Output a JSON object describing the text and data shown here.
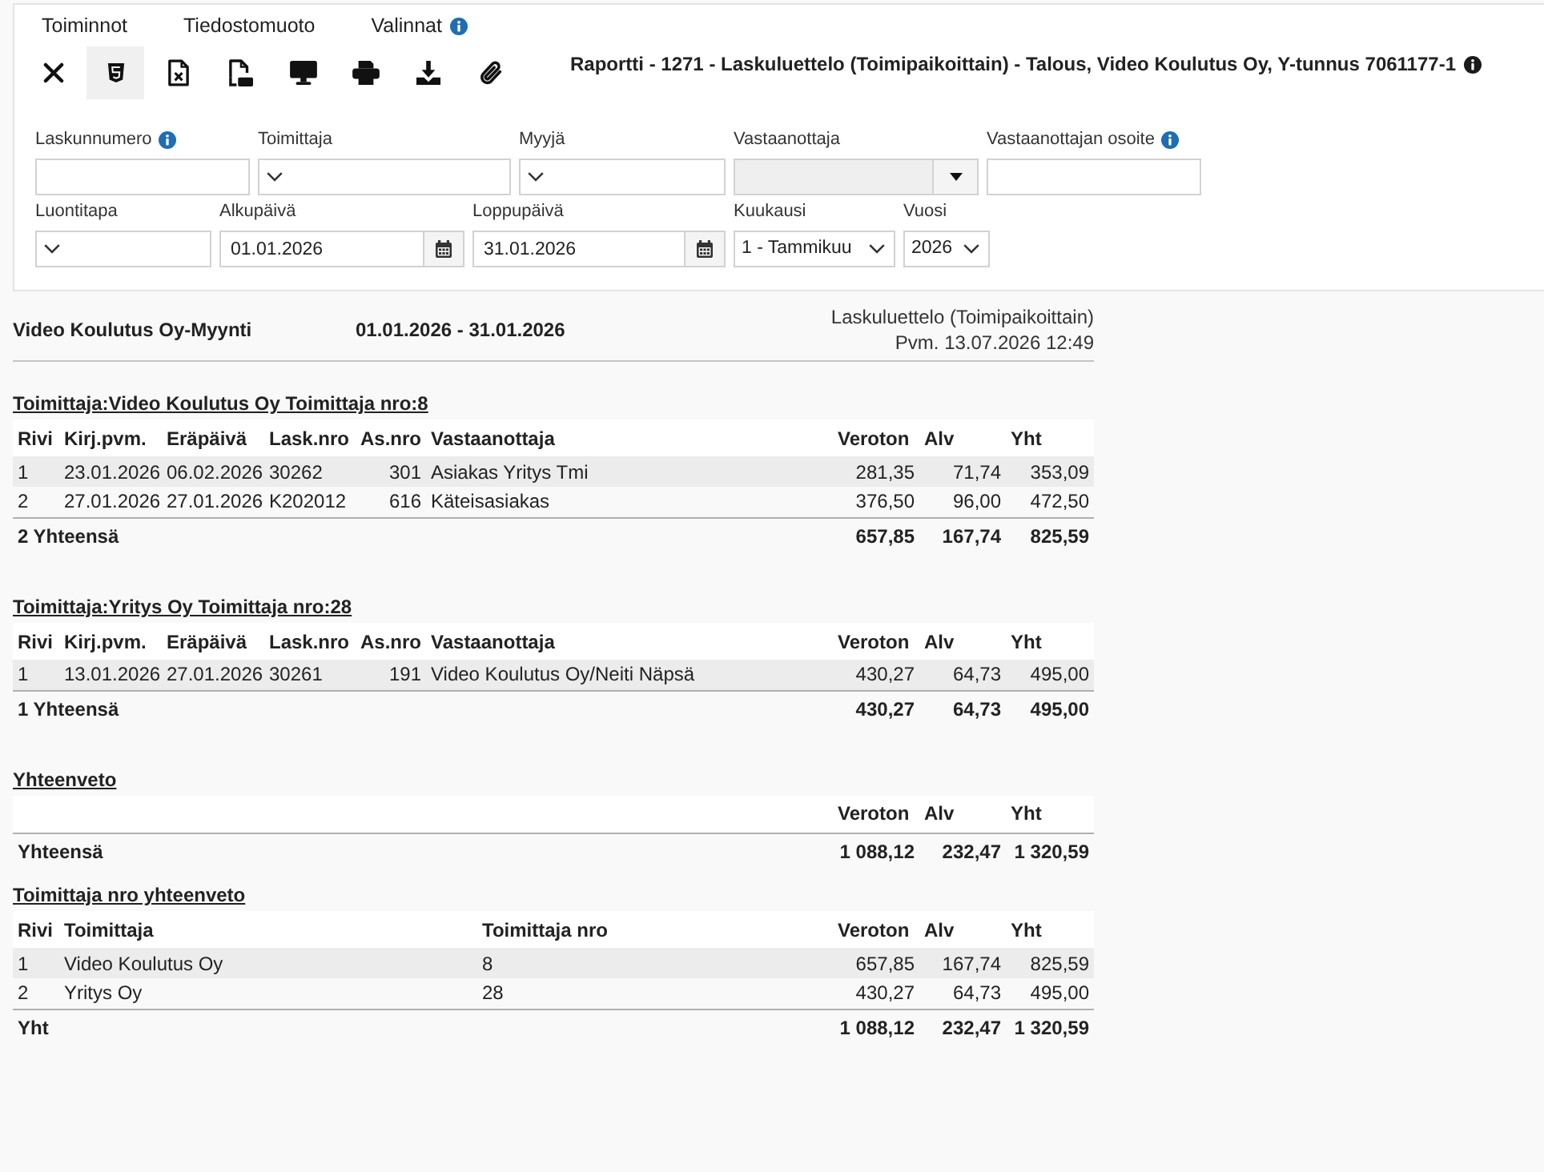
{
  "menu": [
    {
      "label": "Toiminnot",
      "info": false
    },
    {
      "label": "Tiedostomuoto",
      "info": false
    },
    {
      "label": "Valinnat",
      "info": true
    }
  ],
  "toolbar": [
    {
      "kind": "close",
      "selected": false
    },
    {
      "kind": "html",
      "selected": true
    },
    {
      "kind": "excel",
      "selected": false
    },
    {
      "kind": "pdf",
      "selected": false
    },
    {
      "kind": "screen",
      "selected": false
    },
    {
      "kind": "print",
      "selected": false
    },
    {
      "kind": "download",
      "selected": false
    },
    {
      "kind": "attach",
      "selected": false
    }
  ],
  "report_title": {
    "text": "Raportti - 1271 - Laskuluettelo (Toimipaikoittain) - Talous, Video Koulutus Oy, Y-tunnus 7061177-1",
    "info": true
  },
  "filters": [
    [
      {
        "label": "Laskunnumero",
        "kind": "text",
        "info": true,
        "disabled": false
      },
      {
        "label": "Toimittaja",
        "kind": "select",
        "info": false,
        "disabled": false
      },
      {
        "label": "Myyjä",
        "kind": "select",
        "info": false,
        "disabled": false
      },
      {
        "label": "Vastaanottaja",
        "kind": "combo",
        "info": false,
        "disabled": true
      },
      {
        "label": "Vastaanottajan osoite",
        "kind": "text",
        "info": true,
        "disabled": false
      }
    ],
    [
      {
        "label": "Luontitapa",
        "kind": "select",
        "info": false,
        "disabled": false
      },
      {
        "label": "Alkupäivä",
        "kind": "date",
        "info": false,
        "disabled": false,
        "value": "01.01.2026"
      },
      {
        "label": "Loppupäivä",
        "kind": "date",
        "info": false,
        "disabled": false,
        "value": "31.01.2026"
      },
      {
        "label": "Kuukausi",
        "kind": "select",
        "info": false,
        "disabled": false,
        "value": "1 - Tammikuu"
      },
      {
        "label": "Vuosi",
        "kind": "select",
        "info": false,
        "disabled": false,
        "value": "2026"
      }
    ]
  ],
  "report": {
    "company": "Video Koulutus Oy-Myynti",
    "period": "01.01.2026 - 31.01.2026",
    "report_name": "Laskuluettelo (Toimipaikoittain)",
    "printed": "Pvm. 13.07.2026 12:49",
    "sections": [
      {
        "kind": "supplier",
        "heading": "Toimittaja:Video Koulutus Oy Toimittaja nro:8",
        "columns": [
          {
            "label": "Rivi",
            "kind": "text"
          },
          {
            "label": "Kirj.pvm.",
            "kind": "text"
          },
          {
            "label": "Eräpäivä",
            "kind": "text"
          },
          {
            "label": "Lask.nro",
            "kind": "text"
          },
          {
            "label": "As.nro",
            "kind": "num"
          },
          {
            "label": "Vastaanottaja",
            "kind": "text"
          },
          {
            "label": "Veroton",
            "kind": "num"
          },
          {
            "label": "Alv",
            "kind": "num"
          },
          {
            "label": "Yht",
            "kind": "num"
          }
        ],
        "rows": [
          [
            "1",
            "23.01.2026",
            "06.02.2026",
            "30262",
            "301",
            "Asiakas Yritys Tmi",
            "281,35",
            "71,74",
            "353,09"
          ],
          [
            "2",
            "27.01.2026",
            "27.01.2026",
            "K202012",
            "616",
            "Käteisasiakas",
            "376,50",
            "96,00",
            "472,50"
          ]
        ],
        "total": {
          "label": "2 Yhteensä",
          "values": [
            "657,85",
            "167,74",
            "825,59"
          ]
        }
      },
      {
        "kind": "supplier",
        "heading": "Toimittaja:Yritys Oy Toimittaja nro:28",
        "columns": [
          {
            "label": "Rivi",
            "kind": "text"
          },
          {
            "label": "Kirj.pvm.",
            "kind": "text"
          },
          {
            "label": "Eräpäivä",
            "kind": "text"
          },
          {
            "label": "Lask.nro",
            "kind": "text"
          },
          {
            "label": "As.nro",
            "kind": "num"
          },
          {
            "label": "Vastaanottaja",
            "kind": "text"
          },
          {
            "label": "Veroton",
            "kind": "num"
          },
          {
            "label": "Alv",
            "kind": "num"
          },
          {
            "label": "Yht",
            "kind": "num"
          }
        ],
        "rows": [
          [
            "1",
            "13.01.2026",
            "27.01.2026",
            "30261",
            "191",
            "Video Koulutus Oy/Neiti Näpsä",
            "430,27",
            "64,73",
            "495,00"
          ]
        ],
        "total": {
          "label": "1 Yhteensä",
          "values": [
            "430,27",
            "64,73",
            "495,00"
          ]
        }
      },
      {
        "kind": "summary",
        "heading": "Yhteenveto",
        "columns": [
          {
            "label": "Veroton",
            "kind": "num"
          },
          {
            "label": "Alv",
            "kind": "num"
          },
          {
            "label": "Yht",
            "kind": "num"
          }
        ],
        "total": {
          "label": "Yhteensä",
          "values": [
            "1 088,12",
            "232,47",
            "1 320,59"
          ]
        }
      },
      {
        "kind": "supplier_summary",
        "heading": "Toimittaja nro yhteenveto",
        "columns": [
          {
            "label": "Rivi",
            "kind": "text"
          },
          {
            "label": "Toimittaja",
            "kind": "text"
          },
          {
            "label": "Toimittaja nro",
            "kind": "text"
          },
          {
            "label": "Veroton",
            "kind": "num"
          },
          {
            "label": "Alv",
            "kind": "num"
          },
          {
            "label": "Yht",
            "kind": "num"
          }
        ],
        "rows": [
          [
            "1",
            "Video Koulutus Oy",
            "8",
            "657,85",
            "167,74",
            "825,59"
          ],
          [
            "2",
            "Yritys Oy",
            "28",
            "430,27",
            "64,73",
            "495,00"
          ]
        ],
        "total": {
          "label": "Yht",
          "values": [
            "1 088,12",
            "232,47",
            "1 320,59"
          ]
        }
      }
    ]
  }
}
